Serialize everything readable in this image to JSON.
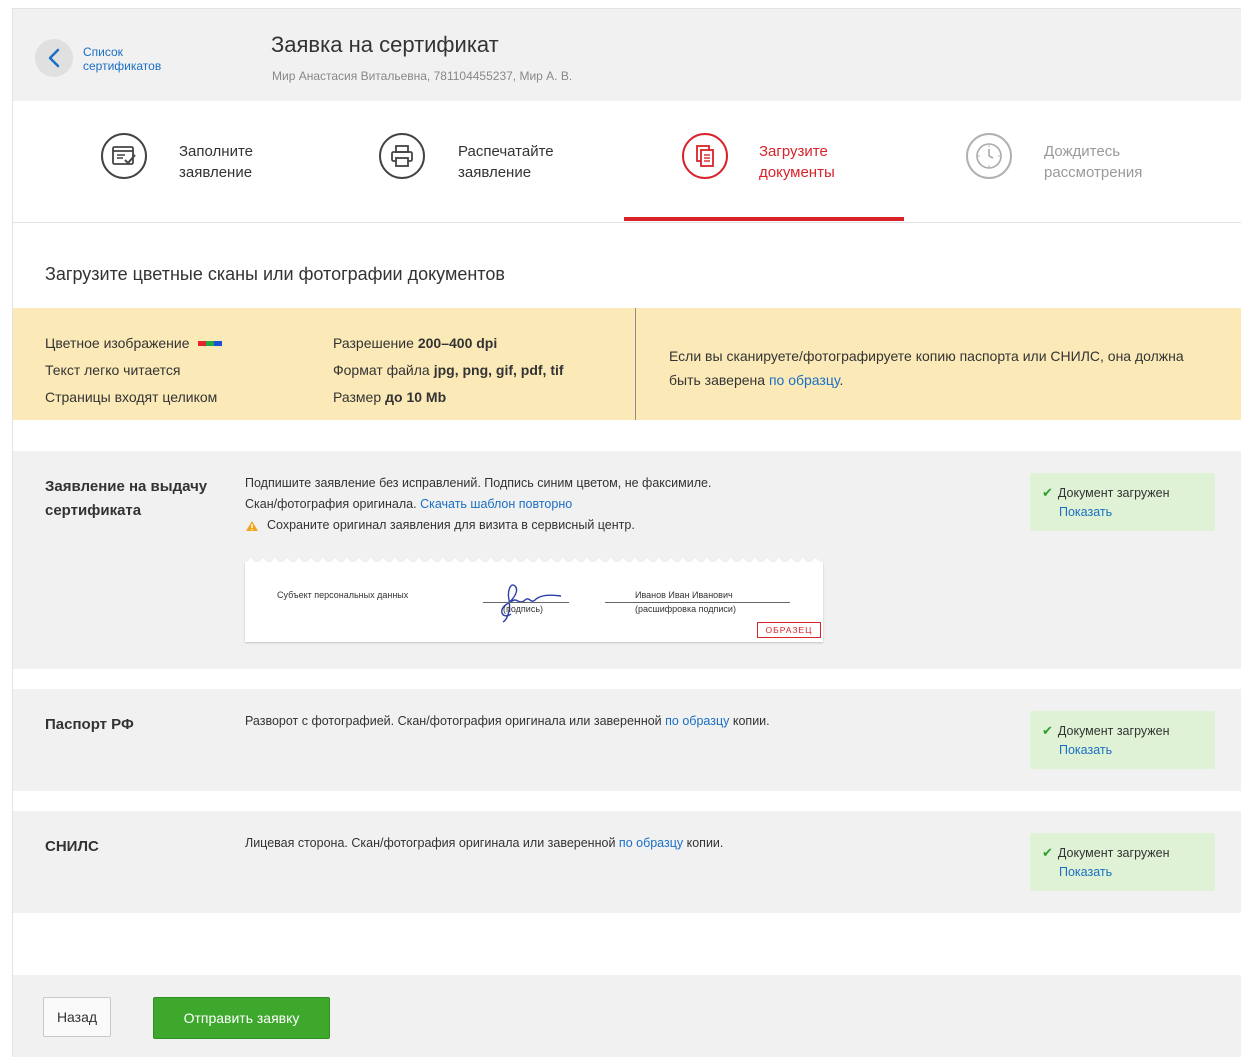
{
  "header": {
    "back_label": "Список сертификатов",
    "title": "Заявка на сертификат",
    "subtitle": "Мир Анастасия Витальевна, 781104455237, Мир А. В."
  },
  "steps": [
    {
      "label": "Заполните заявление",
      "icon": "form-icon",
      "state": "done"
    },
    {
      "label": "Распечатайте заявление",
      "icon": "printer-icon",
      "state": "done"
    },
    {
      "label": "Загрузите документы",
      "icon": "documents-icon",
      "state": "active"
    },
    {
      "label": "Дождитесь рассмотрения",
      "icon": "clock-icon",
      "state": "disabled"
    }
  ],
  "section_title": "Загрузите цветные сканы или фотографии документов",
  "requirements": {
    "col1": [
      "Цветное изображение",
      "Текст легко читается",
      "Страницы входят целиком"
    ],
    "col2": [
      {
        "label": "Разрешение",
        "value": "200–400 dpi"
      },
      {
        "label": "Формат файла",
        "value": "jpg, png, gif, pdf, tif"
      },
      {
        "label": "Размер",
        "value": "до 10 Mb"
      }
    ],
    "note_text": "Если вы сканируете/фотографируете копию паспорта или СНИЛС, она должна быть заверена",
    "note_link": "по образцу",
    "note_end": "."
  },
  "documents": {
    "application": {
      "name": "Заявление на выдачу сертификата",
      "line1": "Подпишите заявление без исправлений. Подпись синим цветом, не факсимиле.",
      "line2": "Скан/фотография оригинала.",
      "line2_link": "Скачать шаблон повторно",
      "warning": "Сохраните оригинал заявления для визита в сервисный центр.",
      "sample": {
        "subject": "Субъект персональных данных",
        "signature_caption": "(подпись)",
        "name": "Иванов Иван Иванович",
        "name_caption": "(расшифровка подписи)",
        "stamp": "ОБРАЗЕЦ"
      }
    },
    "passport": {
      "name": "Паспорт РФ",
      "text": "Разворот с фотографией. Скан/фотография оригинала или заверенной",
      "link": "по образцу",
      "text_end": "копии."
    },
    "snils": {
      "name": "СНИЛС",
      "text": "Лицевая сторона. Скан/фотография оригинала или заверенной",
      "link": "по образцу",
      "text_end": "копии."
    }
  },
  "status": {
    "uploaded": "Документ загружен",
    "show": "Показать"
  },
  "footer": {
    "back": "Назад",
    "submit": "Отправить заявку"
  },
  "colors": {
    "accent": "#d8232a",
    "link": "#1a6fc4",
    "success_bg": "#dff2d6",
    "submit": "#3da82c",
    "requirements_bg": "#fbeab8"
  }
}
